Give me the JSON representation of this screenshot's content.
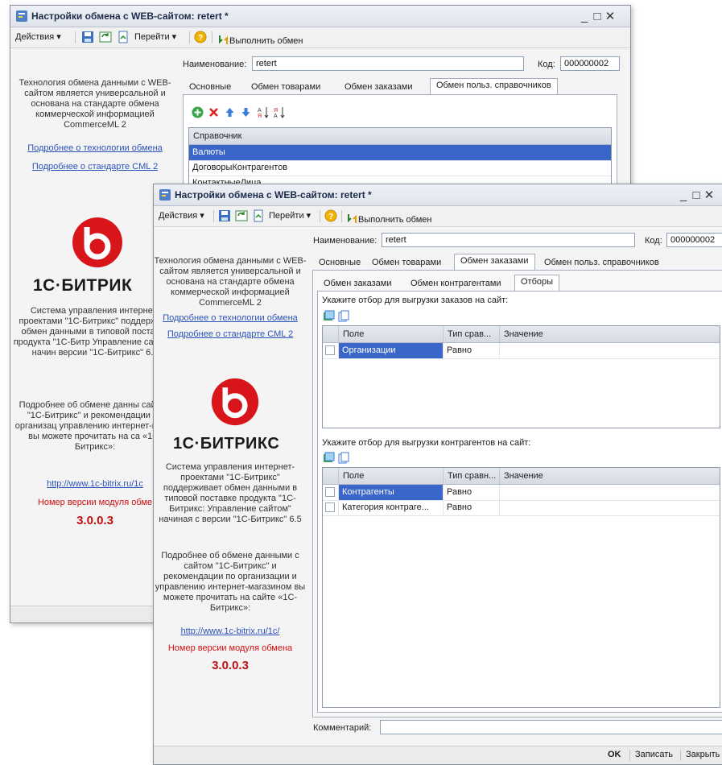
{
  "back_window": {
    "title": "Настройки обмена с WEB-сайтом: retert *",
    "window_buttons": {
      "minimize": "_",
      "maximize": "□",
      "close": "✕"
    },
    "toolbar": {
      "actions": "Действия",
      "goto": "Перейти",
      "run_exchange": "Выполнить обмен",
      "dropdown_arrow": "▾"
    },
    "name_label": "Наименование:",
    "name_value": "retert",
    "code_label": "Код:",
    "code_value": "000000002",
    "tabs": [
      "Основные",
      "Обмен товарами",
      "Обмен заказами",
      "Обмен польз. справочников"
    ],
    "active_tab_index": 3,
    "grid": {
      "header": "Справочник",
      "rows": [
        "Валюты",
        "ДоговорыКонтрагентов",
        "КонтактныеЛица"
      ],
      "selected_row": 0
    },
    "left": {
      "description": "Технология обмена данными с WEB-сайтом является универсальной и основана на стандарте обмена коммерческой информацией CommerceML 2",
      "link_tech": "Подробнее о технологии обмена",
      "link_cml": "Подробнее о стандарте CML 2",
      "logo_text": "1С·БИТРИК",
      "system_desc": "Система управления интернет-проектами \"1С-Битрикс\" поддержива обмен данными в типовой поставке продукта \"1С-Битр Управление сайтом\" начин версии \"1С-Битрикс\" 6.5",
      "more_desc": "Подробнее об обмене данны сайтом \"1С-Битрикс\" и рекомендации по организац управлению интернет-магаз вы можете прочитать на са «1С-Битрикс»:",
      "url": "http://www.1c-bitrix.ru/1c",
      "version_label": "Номер версии модуля обме",
      "version": "3.0.0.3"
    }
  },
  "front_window": {
    "title": "Настройки обмена с WEB-сайтом: retert *",
    "window_buttons": {
      "minimize": "_",
      "maximize": "□",
      "close": "✕"
    },
    "toolbar": {
      "actions": "Действия",
      "goto": "Перейти",
      "run_exchange": "Выполнить обмен",
      "dropdown_arrow": "▾"
    },
    "name_label": "Наименование:",
    "name_value": "retert",
    "code_label": "Код:",
    "code_value": "000000002",
    "tabs": [
      "Основные",
      "Обмен товарами",
      "Обмен заказами",
      "Обмен польз. справочников"
    ],
    "active_tab_index": 2,
    "subtabs": [
      "Обмен заказами",
      "Обмен контрагентами",
      "Отборы"
    ],
    "active_subtab_index": 2,
    "orders_filter": {
      "caption": "Укажите отбор для выгрузки заказов на сайт:",
      "columns": [
        "Поле",
        "Тип срав...",
        "Значение"
      ],
      "rows": [
        {
          "field": "Организации",
          "compare": "Равно",
          "value": ""
        }
      ]
    },
    "contractors_filter": {
      "caption": "Укажите отбор для выгрузки контрагентов на сайт:",
      "columns": [
        "Поле",
        "Тип сравн...",
        "Значение"
      ],
      "rows": [
        {
          "field": "Контрагенты",
          "compare": "Равно",
          "value": ""
        },
        {
          "field": "Категория контраге...",
          "compare": "Равно",
          "value": ""
        }
      ]
    },
    "comment_label": "Комментарий:",
    "comment_value": "",
    "bottom_buttons": {
      "ok": "OK",
      "save": "Записать",
      "close": "Закрыть"
    },
    "left": {
      "description": "Технология обмена данными с WEB-сайтом является универсальной и основана на стандарте обмена коммерческой информацией CommerceML 2",
      "link_tech": "Подробнее о технологии обмена",
      "link_cml": "Подробнее о стандарте CML 2",
      "logo_text": "1С·БИТРИКС",
      "system_desc": "Система управления интернет-проектами \"1С-Битрикс\" поддерживает обмен данными в типовой поставке продукта \"1С-Битрикс: Управление сайтом\" начиная с версии \"1С-Битрикс\" 6.5",
      "more_desc": "Подробнее об обмене данными с сайтом \"1С-Битрикс\" и рекомендации по организации и управлению интернет-магазином вы можете прочитать на сайте «1С-Битрикс»:",
      "url": "http://www.1c-bitrix.ru/1c/",
      "version_label": "Номер версии модуля обмена",
      "version": "3.0.0.3"
    }
  },
  "colors": {
    "accent": "#3b66c9",
    "link": "#2a53b8",
    "logo_red": "#d7151a",
    "version_red": "#c01010"
  }
}
